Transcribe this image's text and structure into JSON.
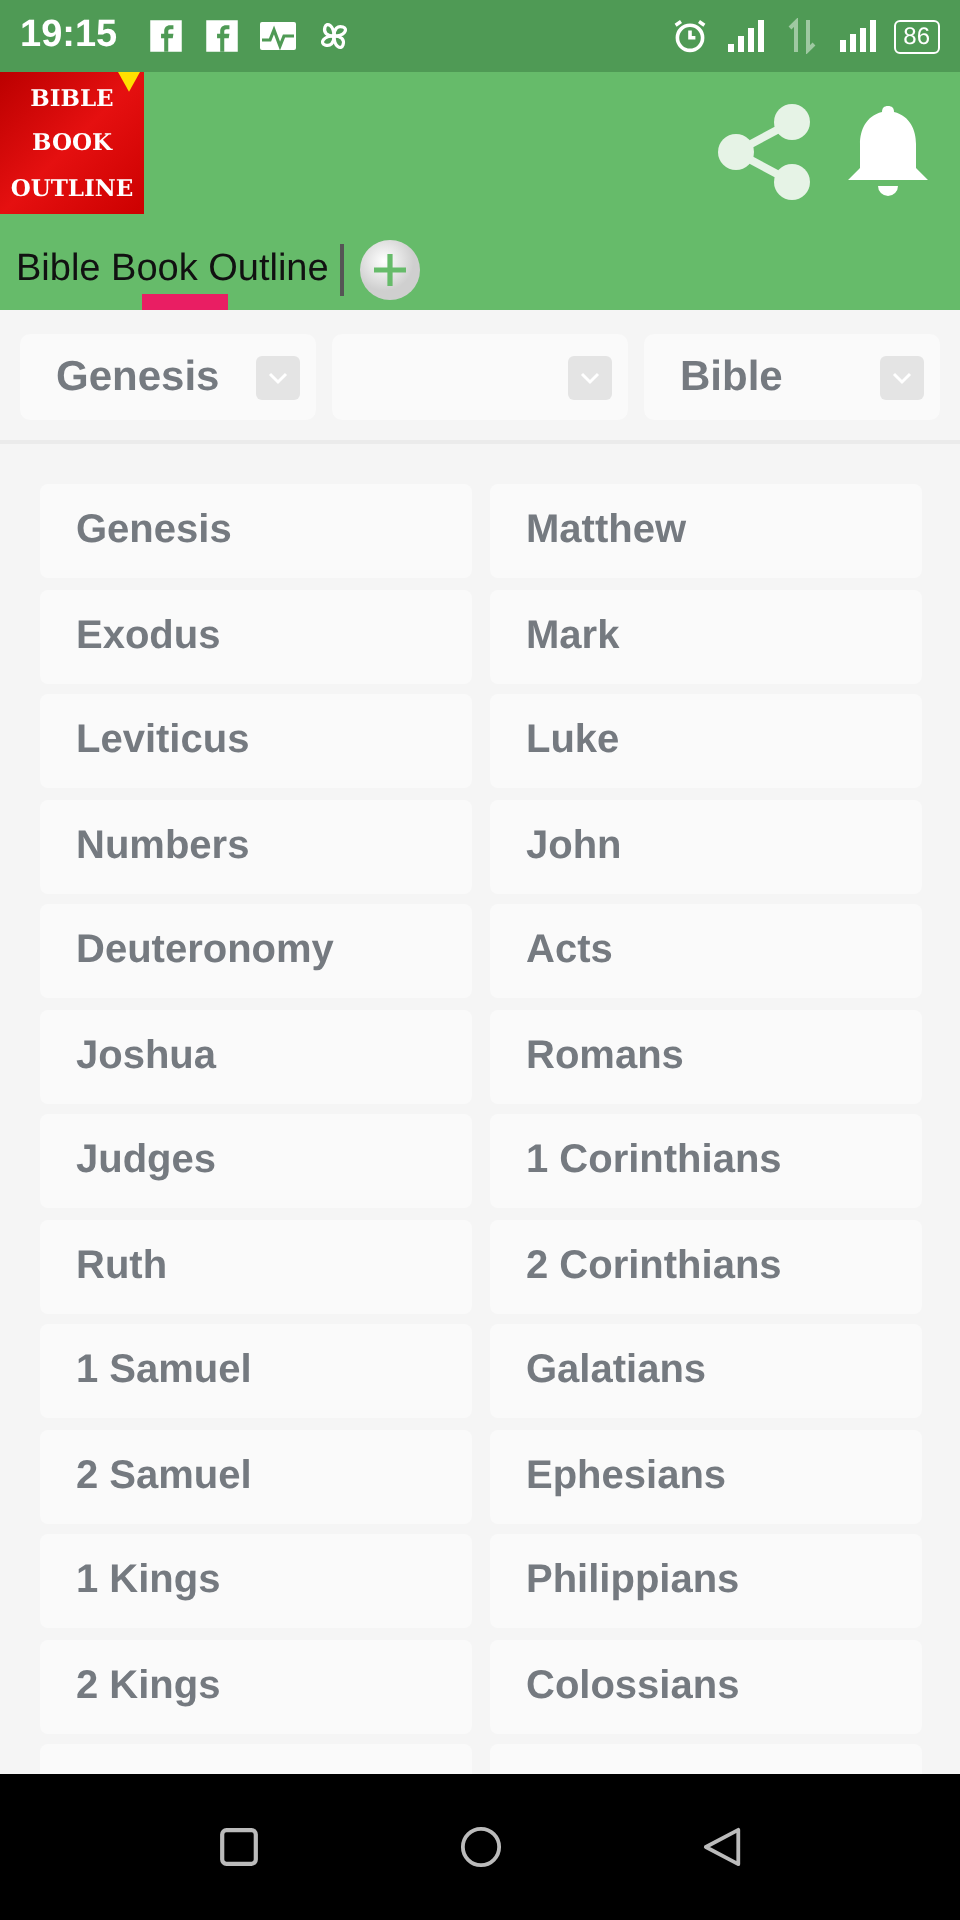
{
  "status_bar": {
    "time": "19:15",
    "battery": "86"
  },
  "header": {
    "logo_lines": [
      "BIBLE",
      "BOOK",
      "OUTLINE"
    ]
  },
  "tabs": [
    {
      "label": "Bible Book Outline",
      "selected": true
    }
  ],
  "dropdowns": [
    {
      "kind": "filled",
      "value": "Genesis"
    },
    {
      "kind": "blank"
    },
    {
      "kind": "filled",
      "value": "Bible"
    }
  ],
  "old_testament": [
    "Genesis",
    "Exodus",
    "Leviticus",
    "Numbers",
    "Deuteronomy",
    "Joshua",
    "Judges",
    "Ruth",
    "1 Samuel",
    "2 Samuel",
    "1 Kings",
    "2 Kings"
  ],
  "new_testament": [
    "Matthew",
    "Mark",
    "Luke",
    "John",
    "Acts",
    "Romans",
    "1 Corinthians",
    "2 Corinthians",
    "Galatians",
    "Ephesians",
    "Philippians",
    "Colossians"
  ]
}
